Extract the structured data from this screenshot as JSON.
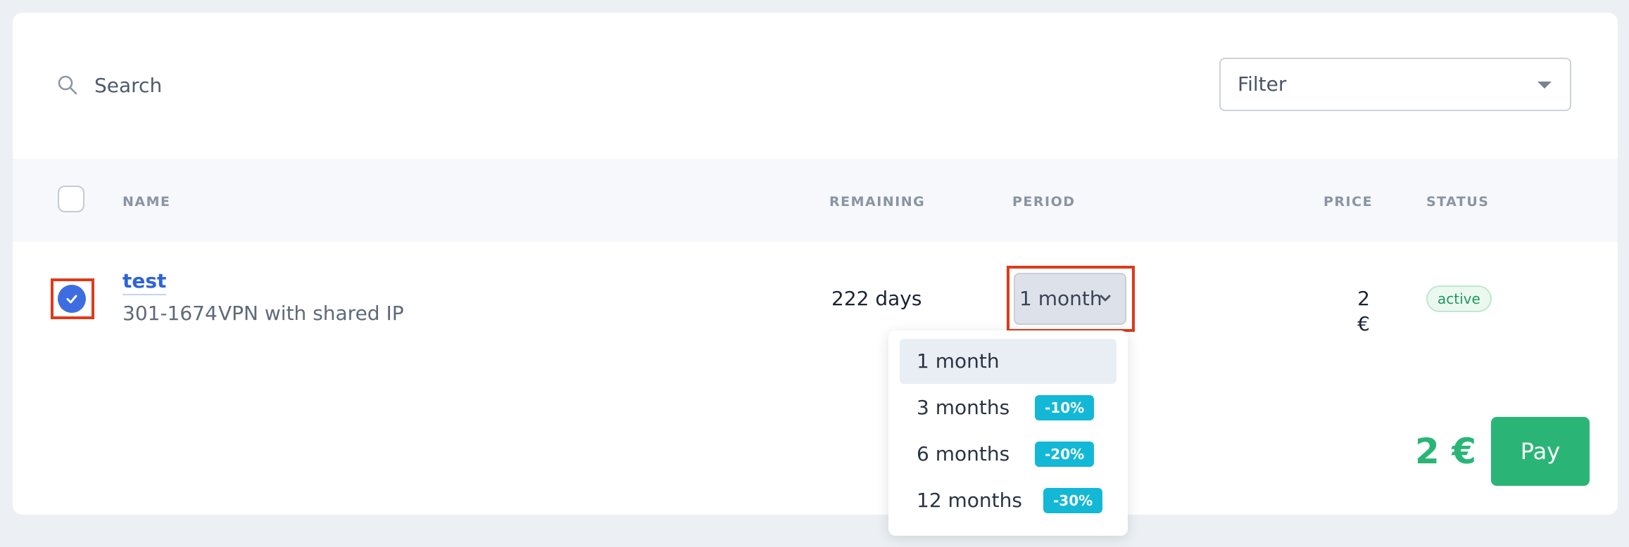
{
  "search": {
    "label": "Search"
  },
  "filter": {
    "label": "Filter"
  },
  "table": {
    "headers": {
      "name": "NAME",
      "remaining": "REMAINING",
      "period": "PERIOD",
      "price": "PRICE",
      "status": "STATUS"
    },
    "rows": [
      {
        "selected": true,
        "name": "test",
        "code": "301-1674",
        "description": "VPN with shared IP",
        "remaining": "222 days",
        "period": "1 month",
        "price": "2 €",
        "status": "active"
      }
    ]
  },
  "period_options": [
    {
      "label": "1 month",
      "discount": "",
      "selected": true
    },
    {
      "label": "3 months",
      "discount": "-10%",
      "selected": false
    },
    {
      "label": "6 months",
      "discount": "-20%",
      "selected": false
    },
    {
      "label": "12 months",
      "discount": "-30%",
      "selected": false
    }
  ],
  "footer": {
    "total": "2 €",
    "pay_label": "Pay"
  },
  "colors": {
    "accent_blue": "#3d6de0",
    "accent_green": "#2ab577",
    "discount_badge": "#13b8d6",
    "highlight_border": "#e0391a"
  },
  "icons": {
    "search": "search-icon",
    "filter_caret": "caret-down-icon",
    "period_chevron": "chevron-down-icon",
    "row_check": "check-icon"
  }
}
